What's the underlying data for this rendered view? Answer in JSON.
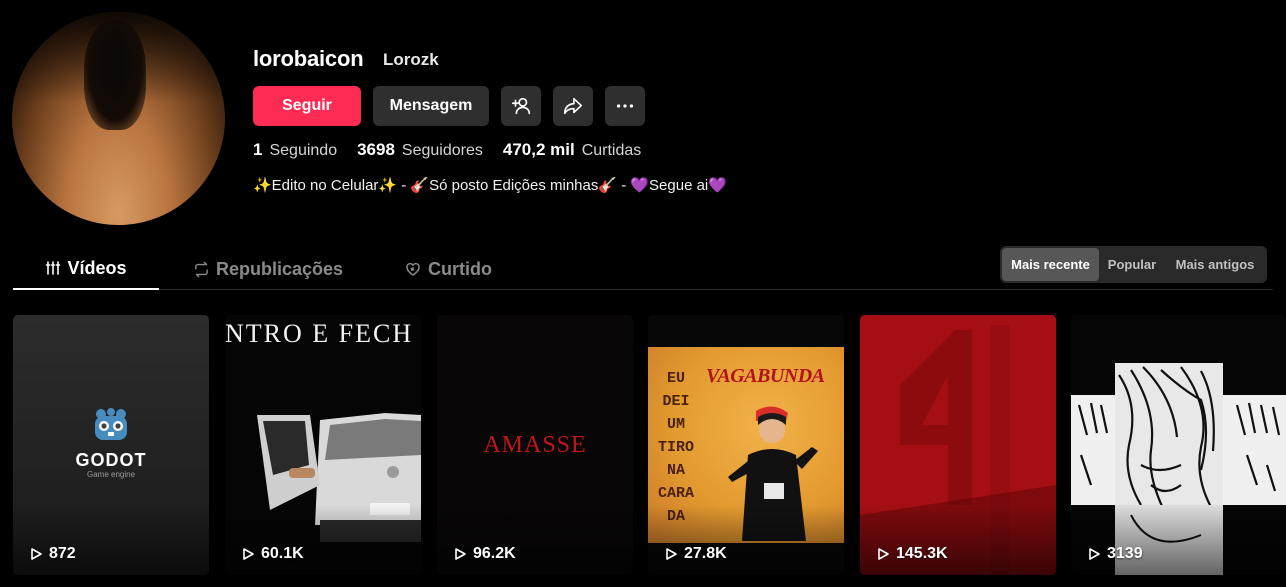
{
  "profile": {
    "username": "lorobaicon",
    "nickname": "Lorozk",
    "bio": "✨Edito no Celular✨ - 🎸Só posto Edições minhas🎸 - 💜Segue ai💜"
  },
  "actions": {
    "follow_label": "Seguir",
    "message_label": "Mensagem",
    "icons": [
      "add-friend-icon",
      "share-icon",
      "more-icon"
    ]
  },
  "stats": {
    "following_count": "1",
    "following_label": "Seguindo",
    "followers_count": "3698",
    "followers_label": "Seguidores",
    "likes_count": "470,2 mil",
    "likes_label": "Curtidas"
  },
  "tabs": [
    {
      "label": "Vídeos",
      "icon": "grid-icon",
      "active": true
    },
    {
      "label": "Republicações",
      "icon": "repost-icon",
      "active": false
    },
    {
      "label": "Curtido",
      "icon": "heart-icon",
      "active": false
    }
  ],
  "sort": {
    "options": [
      "Mais recente",
      "Popular",
      "Mais antigos"
    ],
    "selected": "Mais recente"
  },
  "videos": [
    {
      "views": "872",
      "overlay_text": "GODOT",
      "overlay_sub": "Game engine"
    },
    {
      "views": "60.1K",
      "overlay_text": "NTRO E FECH"
    },
    {
      "views": "96.2K",
      "overlay_text": "AMASSE"
    },
    {
      "views": "27.8K",
      "overlay_text_left": [
        "EU",
        "DEI",
        "UM",
        "TIRO",
        "NA",
        "CARA",
        "DA"
      ],
      "overlay_text_top": "VAGABUNDA"
    },
    {
      "views": "145.3K"
    },
    {
      "views": "3139"
    }
  ],
  "colors": {
    "accent": "#fe2c55",
    "button_bg": "#2f2f2f",
    "background": "#000000"
  }
}
